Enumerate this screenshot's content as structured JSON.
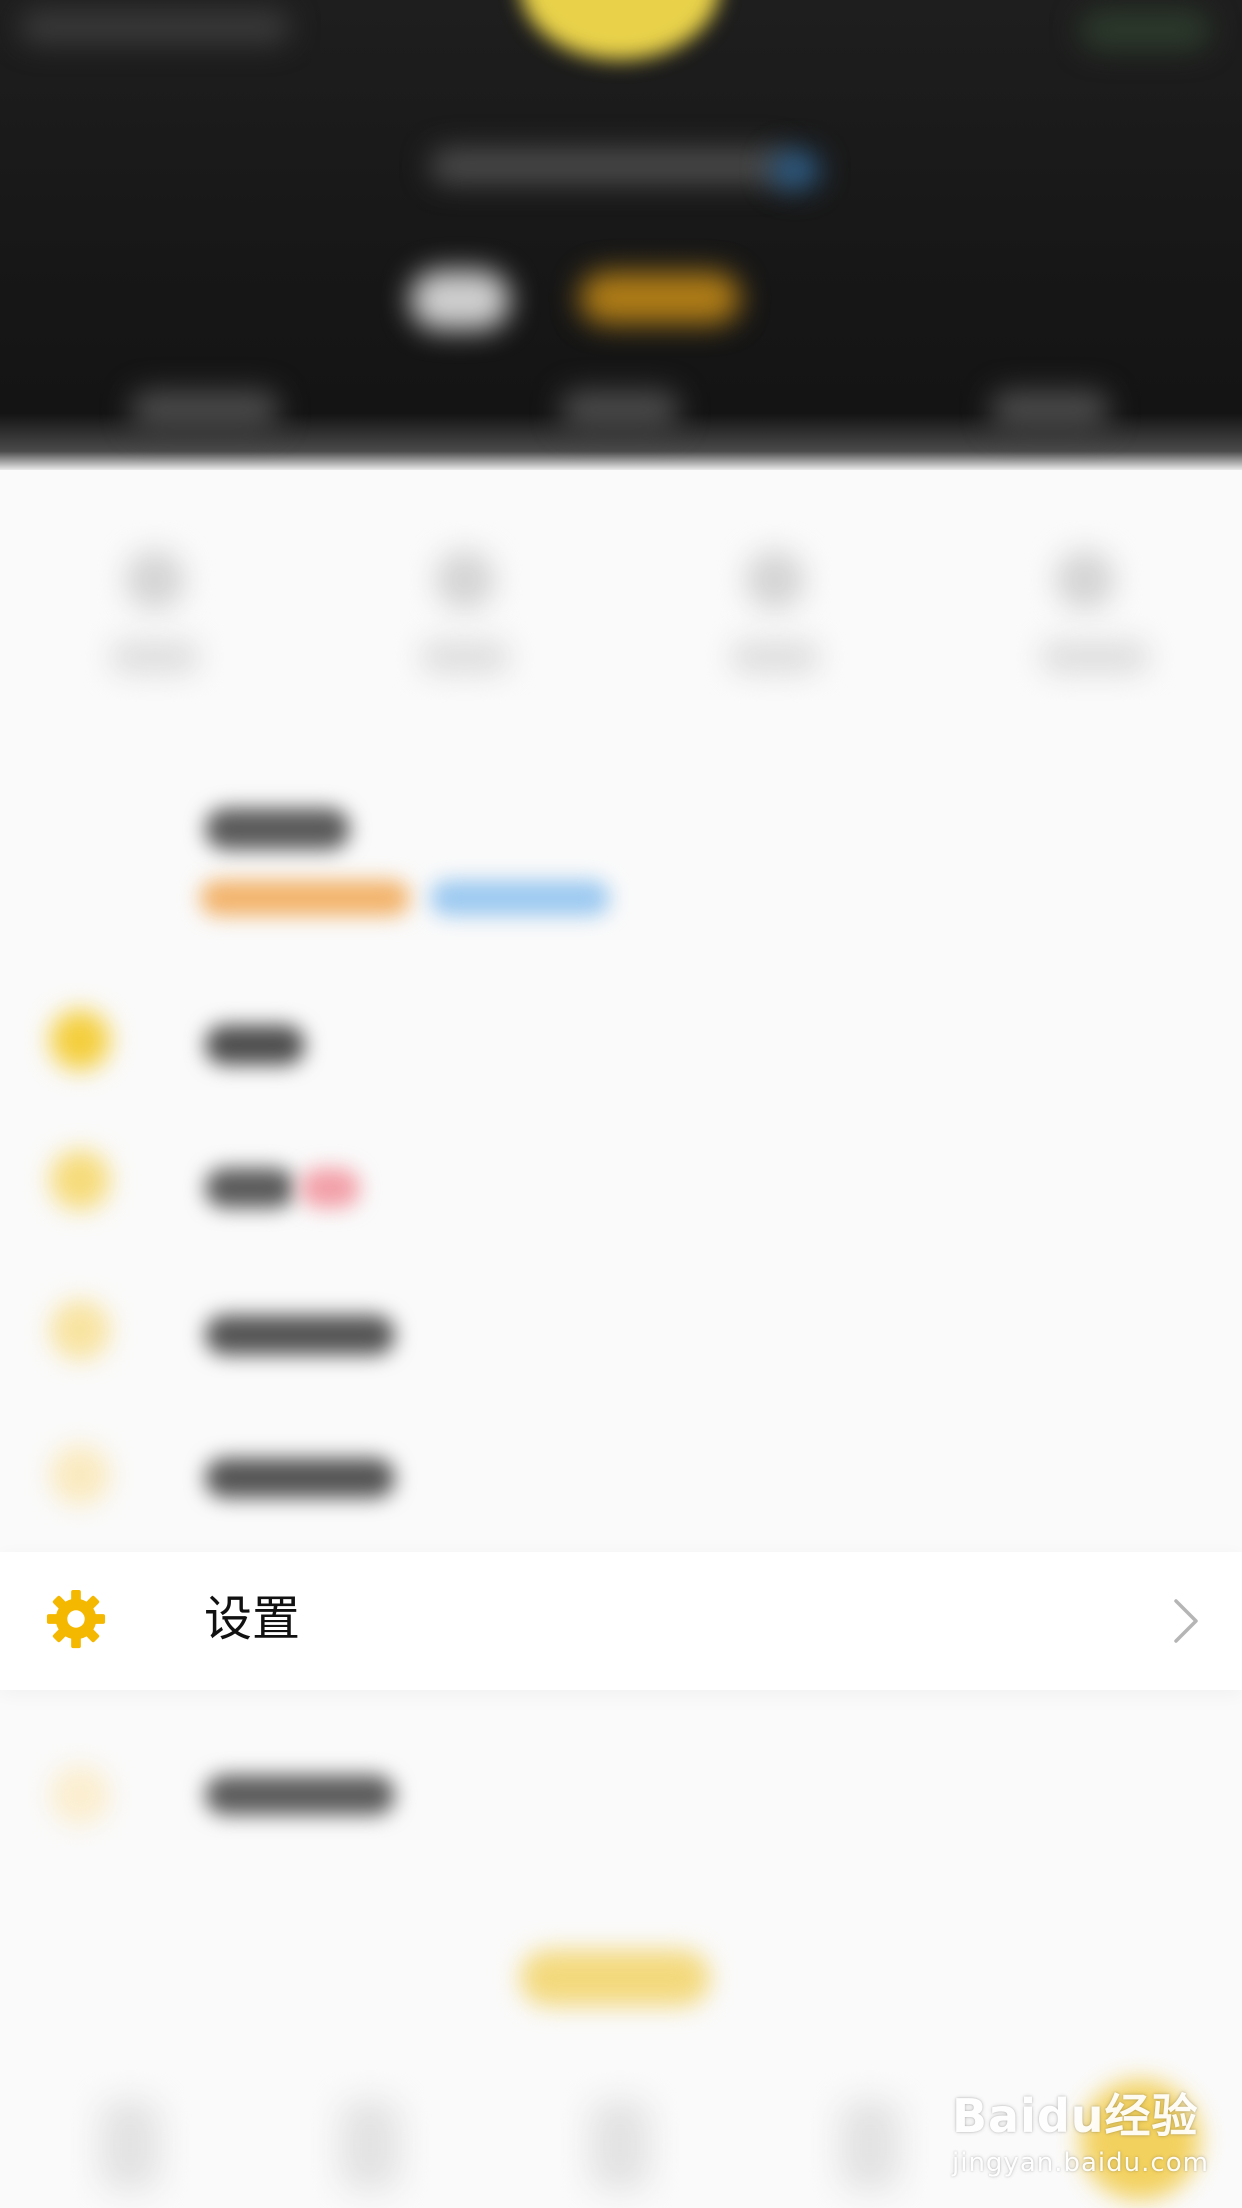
{
  "settings_row": {
    "label": "设置",
    "icon": "gear-icon",
    "accent_color": "#F5B800"
  },
  "watermark": {
    "brand": "Baidu经验",
    "url": "jingyan.baidu.com"
  }
}
